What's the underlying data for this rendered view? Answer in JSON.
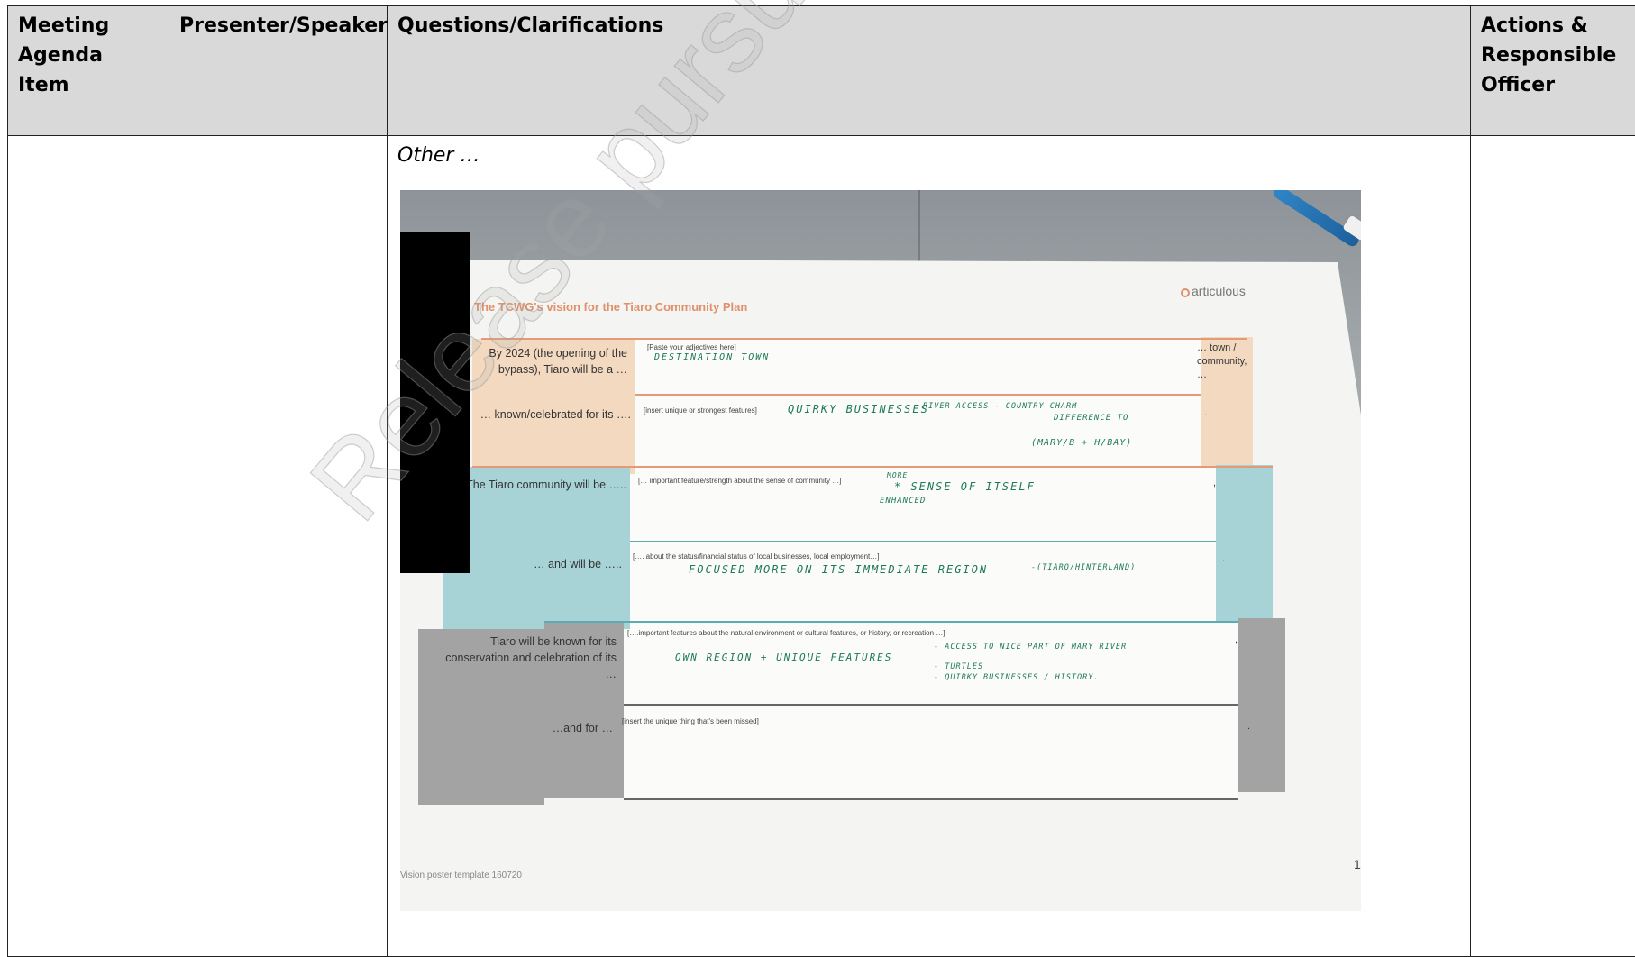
{
  "table": {
    "headers": [
      "Meeting Agenda Item",
      "Presenter/Speaker",
      "Questions/Clarifications",
      "Actions & Responsible Officer"
    ],
    "body_label": "Other …"
  },
  "poster": {
    "title": "The TCWG's vision for the Tiaro Community Plan",
    "brand": "articulous",
    "rows": [
      {
        "label": "By 2024 (the opening of the bypass), Tiaro will be a …",
        "hint": "[Paste your adjectives here]",
        "handwriting": [
          "DESTINATION TOWN"
        ],
        "right": "… town / community, …"
      },
      {
        "label": "… known/celebrated for its ….",
        "hint": "[insert unique or strongest features]",
        "handwriting": [
          "QUIRKY BUSINESSES",
          "RIVER ACCESS - COUNTRY CHARM",
          "DIFFERENCE TO",
          "(MARY/B + H/BAY)"
        ],
        "right": "."
      },
      {
        "label": "The Tiaro community will be …..",
        "hint": "[… important feature/strength about the sense of community …]",
        "handwriting": [
          "MORE",
          "* SENSE OF ITSELF",
          "ENHANCED"
        ],
        "right": ","
      },
      {
        "label": "… and will be …..",
        "hint": "[…. about the status/financial status of local businesses, local employment…]",
        "handwriting": [
          "FOCUSED MORE ON ITS IMMEDIATE REGION",
          "-(TIARO/HINTERLAND)"
        ],
        "right": "."
      },
      {
        "label": "Tiaro will be known for its conservation and celebration of its …",
        "hint": "[….important features about the natural environment or cultural features, or history, or recreation …]",
        "handwriting": [
          "OWN REGION + UNIQUE FEATURES",
          "- ACCESS TO NICE PART OF MARY RIVER",
          "- TURTLES",
          "- QUIRKY BUSINESSES / HISTORY."
        ],
        "right": ","
      },
      {
        "label": "…and for …",
        "hint": "[insert the unique thing that's been missed]",
        "handwriting": [],
        "right": "."
      }
    ],
    "footer": "Vision poster template 160720",
    "page_number": "1"
  },
  "watermark": "Release pursuant to RTI Act",
  "colors": {
    "header_bg": "#d9d9d9",
    "band_peach": "#f2d9c0",
    "band_teal": "#a7d3d6",
    "band_grey": "#a3a3a3",
    "handwriting_ink": "#1c7a55"
  }
}
